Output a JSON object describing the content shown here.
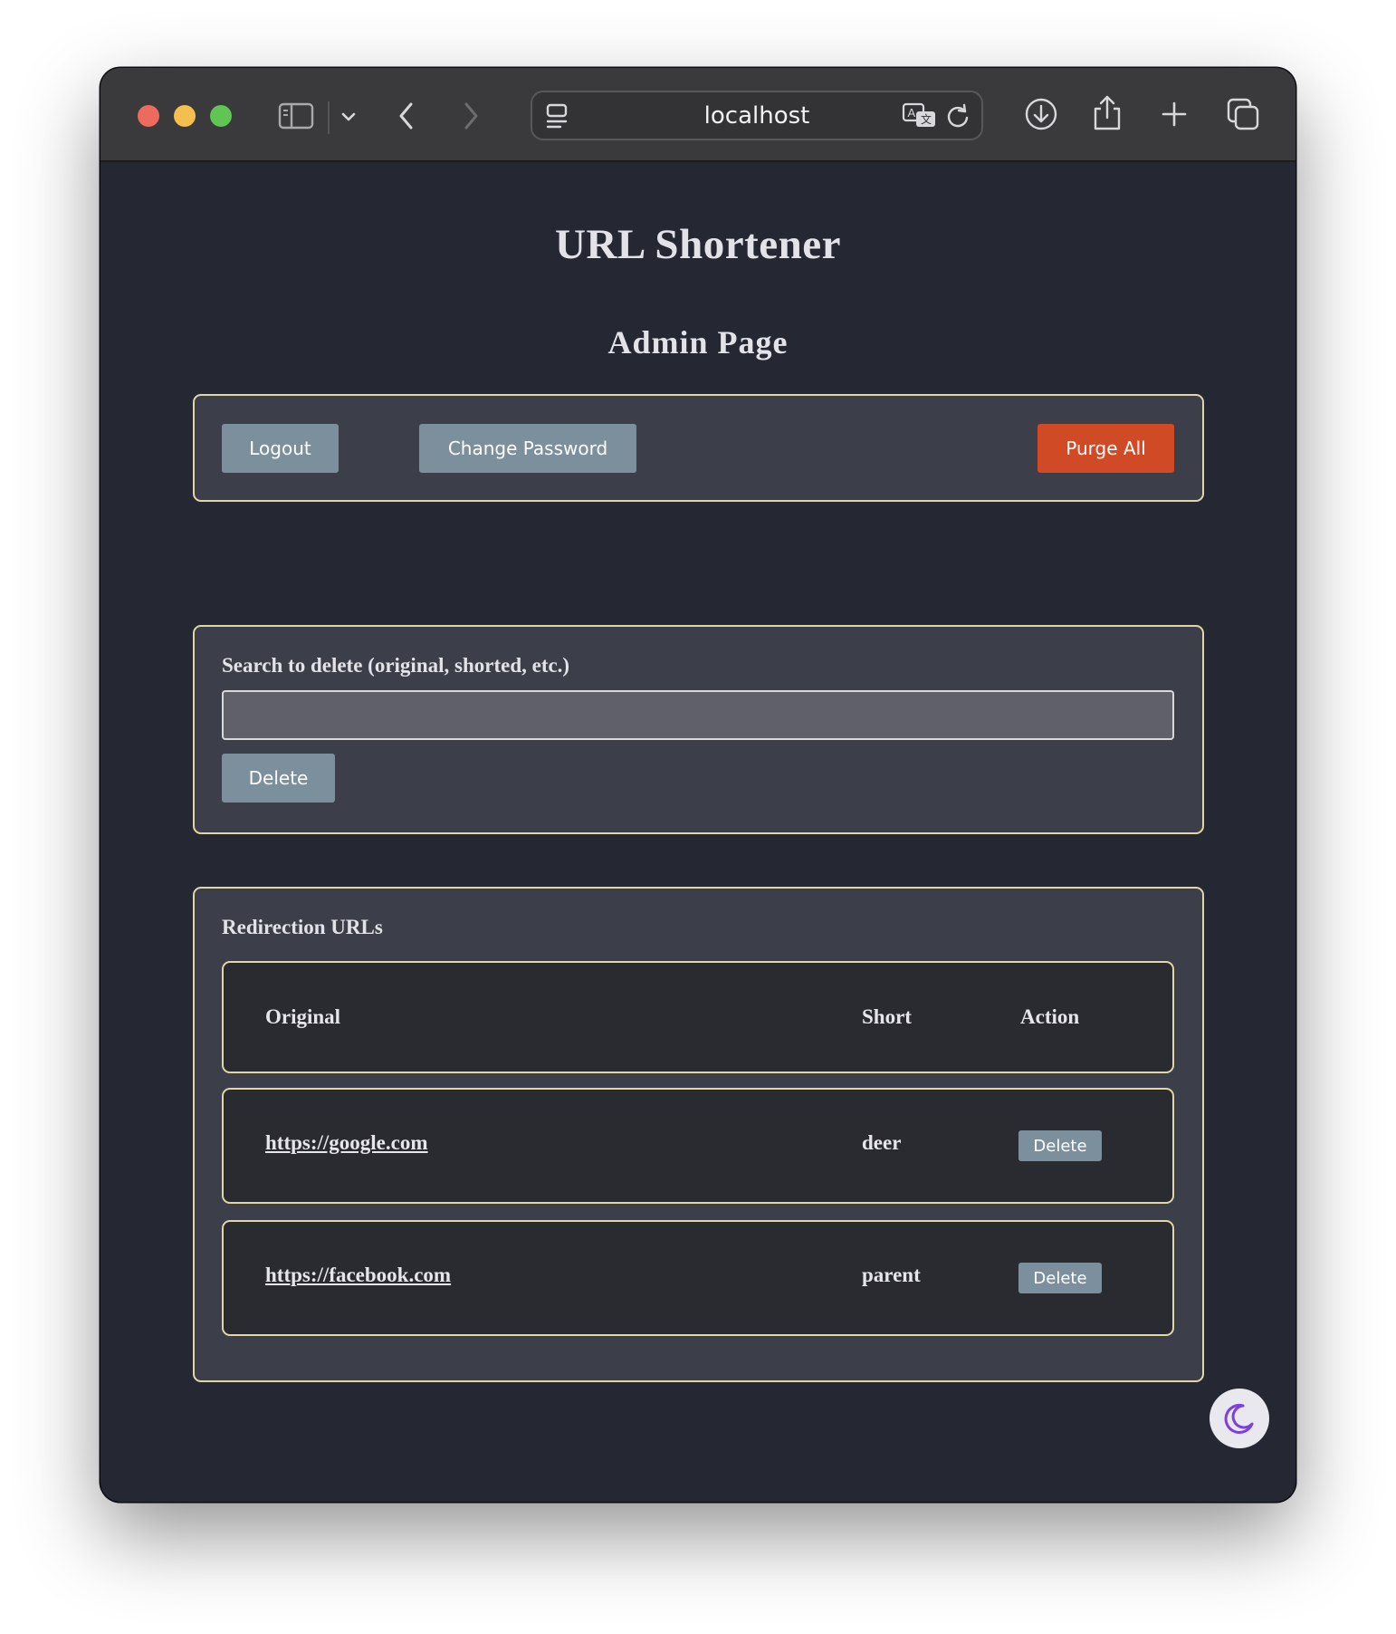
{
  "browser": {
    "address": "localhost",
    "traffic_lights": {
      "close": "#ec6a5e",
      "minimize": "#f4bf4f",
      "maximize": "#61c554"
    }
  },
  "app": {
    "title": "URL Shortener",
    "page_title": "Admin Page"
  },
  "toolbar": {
    "logout_label": "Logout",
    "change_password_label": "Change Password",
    "purge_all_label": "Purge All"
  },
  "search": {
    "label": "Search to delete (original, shorted, etc.)",
    "value": "",
    "placeholder": "",
    "delete_label": "Delete"
  },
  "redirects": {
    "title": "Redirection URLs",
    "columns": [
      "Original",
      "Short",
      "Action"
    ],
    "rows": [
      {
        "original": "https://google.com",
        "short": "deer",
        "action": "Delete"
      },
      {
        "original": "https://facebook.com",
        "short": "parent",
        "action": "Delete"
      }
    ]
  },
  "colors": {
    "page_bg": "#252833",
    "card_bg": "#3c3f4a",
    "card_border": "#e0d6a6",
    "button_grey": "#7c8f9d",
    "button_danger": "#d14a26",
    "moon_icon": "#7b3fe4"
  },
  "icons": {
    "theme_toggle": "moon-icon"
  }
}
